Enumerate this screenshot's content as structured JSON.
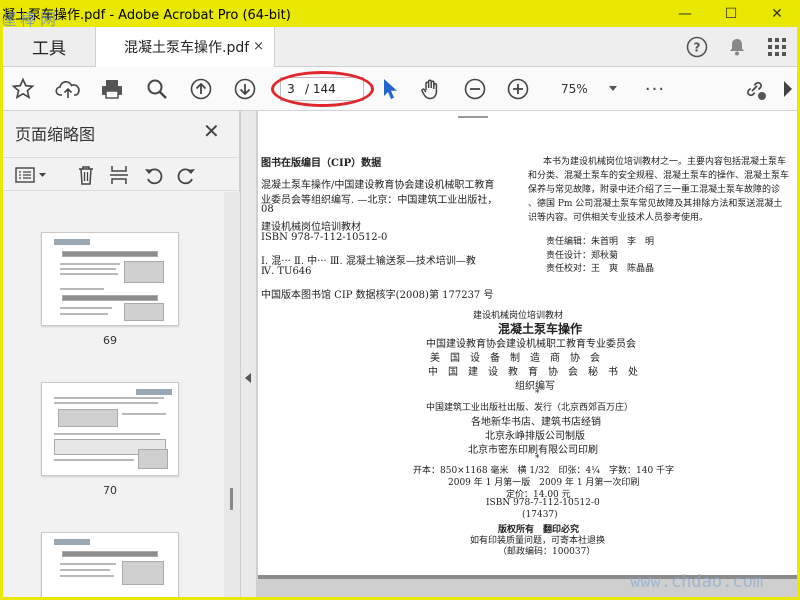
{
  "window": {
    "title": "凝土泵车操作.pdf - Adobe Acrobat Pro (64-bit)",
    "watermark_top": "運棒网",
    "watermark_bottom": "www.chdao.com",
    "controls": {
      "minimize": "—",
      "maximize": "☐",
      "close": "✕"
    }
  },
  "tabs": {
    "tools_label": "工具",
    "document_label": "混凝土泵车操作.pdf",
    "close_glyph": "×"
  },
  "toolbar": {
    "current_page": "3",
    "total_pages": "/ 144",
    "zoom": "75%",
    "more": "···"
  },
  "left_panel": {
    "title": "页面缩略图",
    "close_glyph": "✕",
    "thumbnails": [
      {
        "label": "69"
      },
      {
        "label": "70"
      },
      {
        "label": ""
      }
    ]
  },
  "document": {
    "cip_heading": "图书在版编目（CIP）数据",
    "cip_lines": [
      "混凝土泵车操作/中国建设教育协会建设机械职工教育",
      "业委员会等组织编写. —北京：中国建筑工业出版社，",
      "08",
      "建设机械岗位培训教材",
      "ISBN 978-7-112-10512-0",
      "Ⅰ. 混··· Ⅱ. 中··· Ⅲ. 混凝土输送泵—技术培训—教",
      "Ⅳ. TU646",
      "中国版本图书馆 CIP 数据核字(2008)第 177237 号"
    ],
    "summary_lines": [
      "本书为建设机械岗位培训教材之一。主要内容包括混凝土泵车",
      "和分类、混凝土泵车的安全规程、混凝土泵车的操作、混凝土泵车",
      "保养与常见故障，附录中还介绍了三一重工混凝土泵车故障的诊",
      "、德国 Pm 公司混凝土泵车常见故障及其排除方法和泵送混凝土",
      "识等内容。可供相关专业技术人员参考使用。"
    ],
    "editors": [
      "责任编辑：朱首明　李　明",
      "责任设计：郑秋菊",
      "责任校对：王　爽　陈晶晶"
    ],
    "series": "建设机械岗位培训教材",
    "book_title": "混凝土泵车操作",
    "org_lines": [
      "中国建设教育协会建设机械职工教育专业委员会",
      "美　国　设　备　制　造　商　协　会",
      "中　国　建　设　教　育　协　会　秘　书　处",
      "组织编写",
      "*",
      "中国建筑工业出版社出版、发行（北京西郊百万庄）",
      "各地新华书店、建筑书店经销",
      "北京永峥排版公司制版",
      "北京市密东印刷有限公司印刷",
      "*",
      "开本：850×1168 毫米　横 1/32　印张：4¼　字数：140 千字",
      "2009 年 1 月第一版　2009 年 1 月第一次印刷",
      "定价：14.00 元",
      "ISBN 978-7-112-10512-0",
      "(17437)",
      "版权所有　翻印必究",
      "如有印装质量问题，可寄本社退换",
      "（邮政编码：100037）"
    ]
  },
  "colors": {
    "titlebar": "#e8e800",
    "annotation_red": "#e0262b",
    "cursor_blue": "#2266cc"
  }
}
